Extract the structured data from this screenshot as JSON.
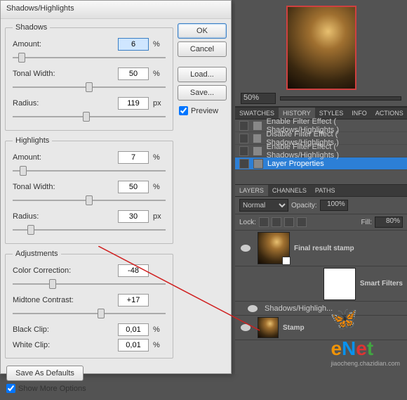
{
  "dialog": {
    "title": "Shadows/Highlights",
    "shadows": {
      "legend": "Shadows",
      "amount_label": "Amount:",
      "amount": "6",
      "amount_unit": "%",
      "tonal_label": "Tonal Width:",
      "tonal": "50",
      "tonal_unit": "%",
      "radius_label": "Radius:",
      "radius": "119",
      "radius_unit": "px"
    },
    "highlights": {
      "legend": "Highlights",
      "amount_label": "Amount:",
      "amount": "7",
      "amount_unit": "%",
      "tonal_label": "Tonal Width:",
      "tonal": "50",
      "tonal_unit": "%",
      "radius_label": "Radius:",
      "radius": "30",
      "radius_unit": "px"
    },
    "adjustments": {
      "legend": "Adjustments",
      "color_label": "Color Correction:",
      "color": "-48",
      "midtone_label": "Midtone Contrast:",
      "midtone": "+17",
      "black_label": "Black Clip:",
      "black": "0,01",
      "black_unit": "%",
      "white_label": "White Clip:",
      "white": "0,01",
      "white_unit": "%"
    },
    "save_defaults": "Save As Defaults",
    "show_more": "Show More Options",
    "buttons": {
      "ok": "OK",
      "cancel": "Cancel",
      "load": "Load...",
      "save": "Save..."
    },
    "preview_label": "Preview"
  },
  "preview": {
    "zoom": "50%"
  },
  "tabs_upper": [
    "SWATCHES",
    "HISTORY",
    "STYLES",
    "INFO",
    "ACTIONS"
  ],
  "history": [
    {
      "label": "Enable Filter Effect ( Shadows/Highlights )"
    },
    {
      "label": "Disable Filter Effect ( Shadows/Highlights )"
    },
    {
      "label": "Enable Filter Effect ( Shadows/Highlights )"
    },
    {
      "label": "Layer Properties"
    }
  ],
  "tabs_lower": [
    "LAYERS",
    "CHANNELS",
    "PATHS"
  ],
  "layers_panel": {
    "blend": "Normal",
    "opacity_label": "Opacity:",
    "opacity": "100%",
    "lock_label": "Lock:",
    "fill_label": "Fill:",
    "fill": "80%"
  },
  "layers": {
    "final": "Final result stamp",
    "smart_filters": "Smart Filters",
    "sh_filter": "Shadows/Highligh...",
    "stamp": "Stamp"
  }
}
